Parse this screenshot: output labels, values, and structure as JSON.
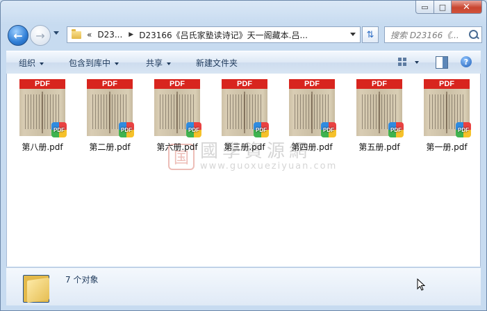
{
  "window": {
    "caption_buttons": {
      "minimize": "▭",
      "maximize": "□",
      "close": "✕"
    }
  },
  "nav": {
    "back_icon": "back-arrow-icon",
    "forward_icon": "forward-arrow-icon",
    "breadcrumb": {
      "overflow": "«",
      "items": [
        "D23...",
        "D23166《吕氏家塾读诗记》天一阁藏本.吕..."
      ]
    },
    "search_placeholder": "搜索 D23166《..."
  },
  "toolbar": {
    "organize": "组织",
    "include_in_library": "包含到库中",
    "share": "共享",
    "new_folder": "新建文件夹"
  },
  "files": [
    {
      "name": "第八册.pdf",
      "band": "PDF",
      "badge": "PDF"
    },
    {
      "name": "第二册.pdf",
      "band": "PDF",
      "badge": "PDF"
    },
    {
      "name": "第六册.pdf",
      "band": "PDF",
      "badge": "PDF"
    },
    {
      "name": "第三册.pdf",
      "band": "PDF",
      "badge": "PDF"
    },
    {
      "name": "第四册.pdf",
      "band": "PDF",
      "badge": "PDF"
    },
    {
      "name": "第五册.pdf",
      "band": "PDF",
      "badge": "PDF"
    },
    {
      "name": "第一册.pdf",
      "band": "PDF",
      "badge": "PDF"
    }
  ],
  "watermark": {
    "seal": "国",
    "title": "國學資源網",
    "url": "www.guoxueziyuan.com"
  },
  "details": {
    "count_text": "7 个对象"
  },
  "colors": {
    "pdf_red": "#d8251e",
    "chrome_blue": "#c7dbf0",
    "close_red": "#c8452f"
  }
}
